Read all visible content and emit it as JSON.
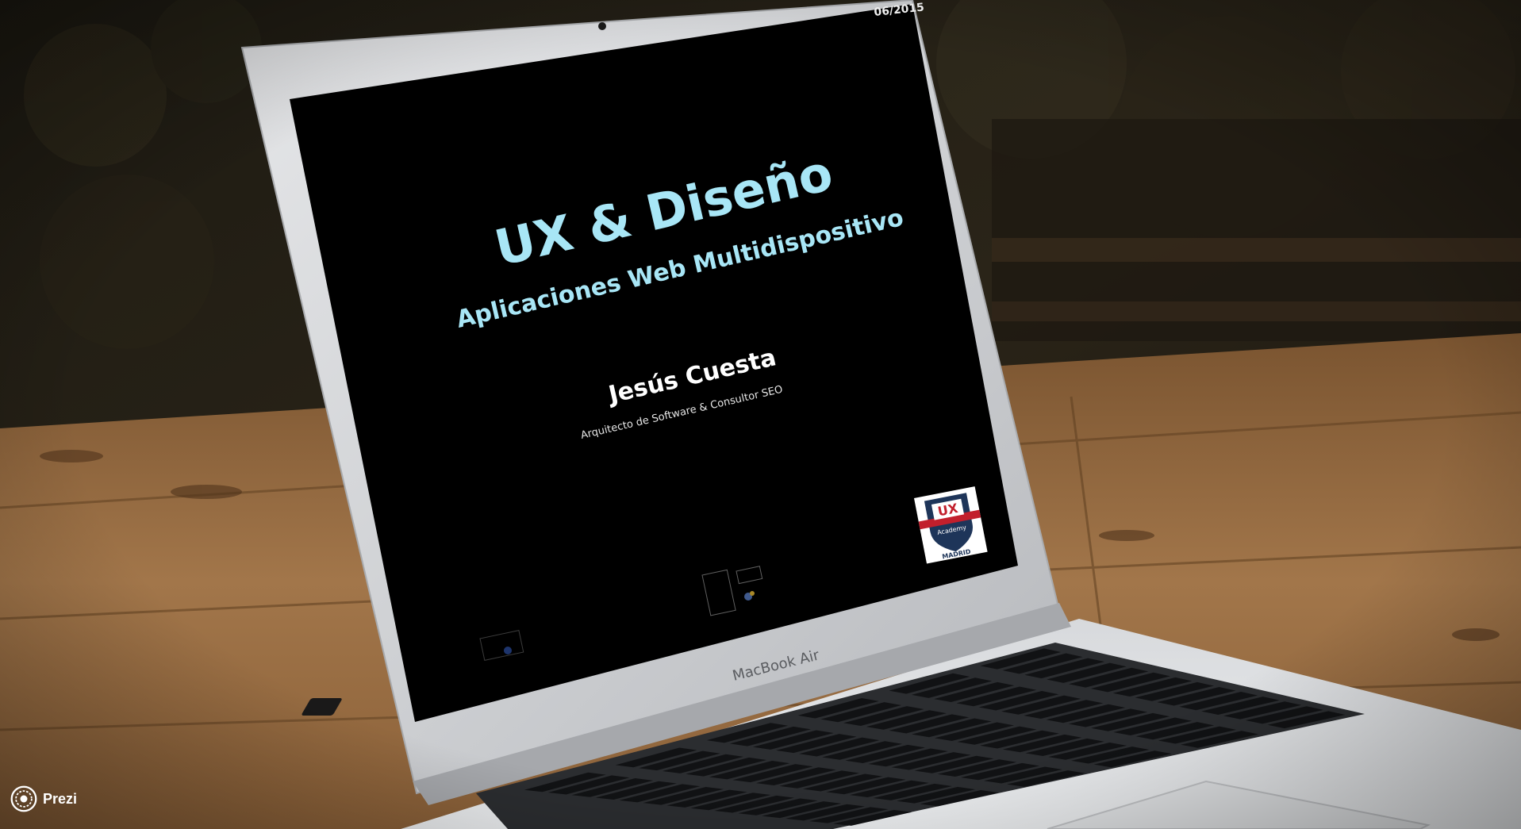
{
  "slide": {
    "date": "06/2015",
    "title": "UX & Diseño",
    "subtitle": "Aplicaciones Web Multidispositivo",
    "author": "Jesús Cuesta",
    "author_role": "Arquitecto de Software & Consultor SEO"
  },
  "badge": {
    "ux": "UX",
    "academy": "Academy",
    "city": "MADRID"
  },
  "laptop": {
    "brand_label": "MacBook Air"
  },
  "watermark": {
    "label": "Prezi"
  },
  "colors": {
    "title": "#a8e6f6",
    "author": "#ffffff",
    "screen_bg": "#000000",
    "badge_red": "#c21f2c",
    "badge_navy": "#1e3559"
  }
}
